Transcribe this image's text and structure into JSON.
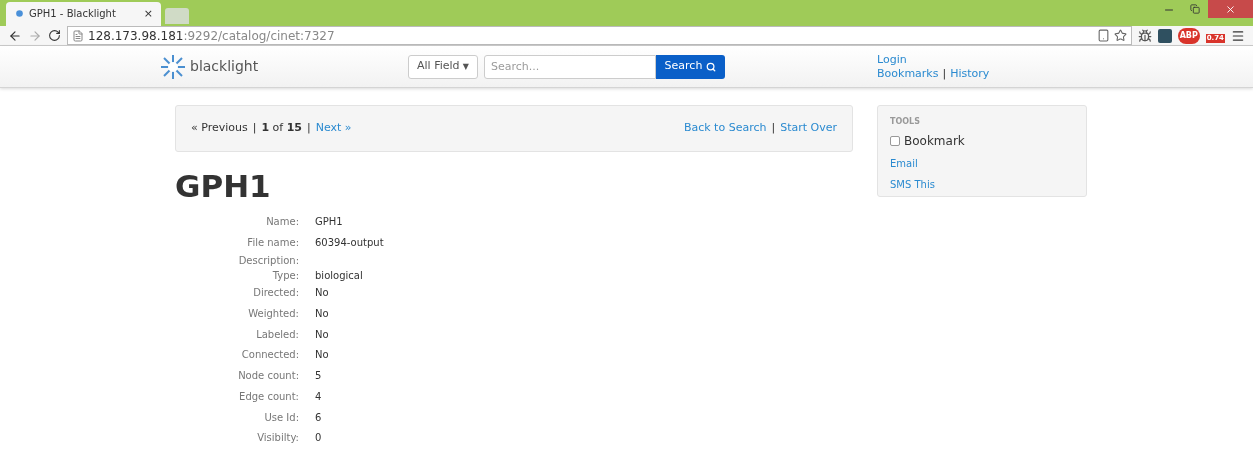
{
  "browser": {
    "tab_title": "GPH1 - Blacklight",
    "tab_close": "×",
    "url_host": "128.173.98.181",
    "url_path": ":9292/catalog/cinet:7327",
    "extension_badges": [
      "ABP",
      "0.74"
    ]
  },
  "navbar": {
    "logo_text": "blacklight",
    "search_field_select": "All Field",
    "select_caret": "▼",
    "link_separator": "|",
    "search_placeholder": "Search...",
    "search_button": "Search",
    "links": [
      {
        "label": "Login"
      },
      {
        "label": "Bookmarks"
      },
      {
        "label": "History"
      }
    ]
  },
  "pager": {
    "separators": [
      "|",
      "|",
      "|"
    ],
    "previous": "« Previous",
    "current": "1",
    "of": "of",
    "total": "15",
    "next": "Next »",
    "back": "Back to Search",
    "start_over": "Start Over"
  },
  "title": "GPH1",
  "fields": [
    {
      "label": "Name:",
      "value": "GPH1"
    },
    {
      "label": "File name:",
      "value": "60394-output"
    },
    {
      "label": "Description:"
    },
    {
      "label": "Type:",
      "value": "biological"
    },
    {
      "label": "Directed:",
      "value": "No"
    },
    {
      "label": "Weighted:",
      "value": "No"
    },
    {
      "label": "Labeled:",
      "value": "No"
    },
    {
      "label": "Connected:",
      "value": "No"
    },
    {
      "label": "Node count:",
      "value": "5"
    },
    {
      "label": "Edge count:",
      "value": "4"
    },
    {
      "label": "Use Id:",
      "value": "6"
    },
    {
      "label": "Visibilty:",
      "value": "0"
    }
  ],
  "tools": {
    "heading": "TOOLS",
    "bookmark": {
      "label": "Bookmark",
      "checked": false
    },
    "links": [
      "Email",
      "SMS This"
    ]
  }
}
